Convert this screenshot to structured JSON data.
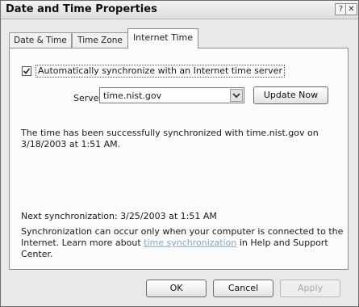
{
  "window": {
    "title": "Date and Time Properties",
    "help_glyph": "?",
    "close_glyph": "✕"
  },
  "tabs": [
    {
      "label": "Date & Time",
      "active": false
    },
    {
      "label": "Time Zone",
      "active": false
    },
    {
      "label": "Internet Time",
      "active": true
    }
  ],
  "sync": {
    "checkbox_checked": true,
    "checkbox_label": "Automatically synchronize with an Internet time server"
  },
  "server": {
    "label": "Server:",
    "value": "time.nist.gov",
    "update_button": "Update Now"
  },
  "messages": {
    "status": "The time has been successfully synchronized with time.nist.gov on 3/18/2003 at 1:51 AM.",
    "next_sync": "Next synchronization: 3/25/2003 at 1:51 AM",
    "info_prefix": "Synchronization can occur only when your computer is connected to the Internet.  Learn more about ",
    "info_link": "time synchronization",
    "info_suffix": " in Help and Support Center."
  },
  "buttons": {
    "ok": "OK",
    "cancel": "Cancel",
    "apply": "Apply"
  },
  "colors": {
    "link": "#8aa6c8",
    "disabled_text": "#a8a8a8"
  }
}
